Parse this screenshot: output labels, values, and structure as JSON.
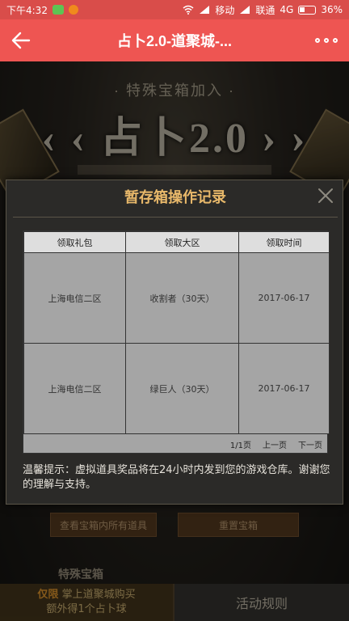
{
  "status_bar": {
    "time": "下午4:32",
    "carrier1": "移动",
    "carrier2": "联通",
    "network": "4G",
    "battery": "36%",
    "battery_level": 0.36
  },
  "title_bar": {
    "title": "占卜2.0-道聚城-...",
    "back_icon": "back-arrow-icon",
    "more_icon": "more-icon"
  },
  "background": {
    "banner_sub": "· 特殊宝箱加入 ·",
    "banner_main": "‹ ‹ 占卜2.0 › ›",
    "view_all_button": "查看宝箱内所有道具",
    "reset_button": "重置宝箱",
    "special_label": "特殊宝箱",
    "buy_highlight": "仅限",
    "buy_line1": "掌上道聚城购买",
    "buy_line2": "额外得1个占卜球",
    "rules_button": "活动规则"
  },
  "modal": {
    "title": "暂存箱操作记录",
    "close_icon": "close-icon",
    "table": {
      "headers": [
        "领取礼包",
        "领取大区",
        "领取时间"
      ],
      "rows": [
        [
          "上海电信二区",
          "收割者（30天）",
          "2017-06-17"
        ],
        [
          "上海电信二区",
          "绿巨人（30天）",
          "2017-06-17"
        ]
      ]
    },
    "pager": {
      "page_info": "1/1页",
      "prev": "上一页",
      "next": "下一页"
    },
    "tip": "温馨提示：虚拟道具奖品将在24小时内发到您的游戏仓库。谢谢您的理解与支持。"
  },
  "colors": {
    "title_bar": "#ee5552",
    "modal_title": "#e8b86a",
    "table_cell": "#a5a5a5"
  }
}
